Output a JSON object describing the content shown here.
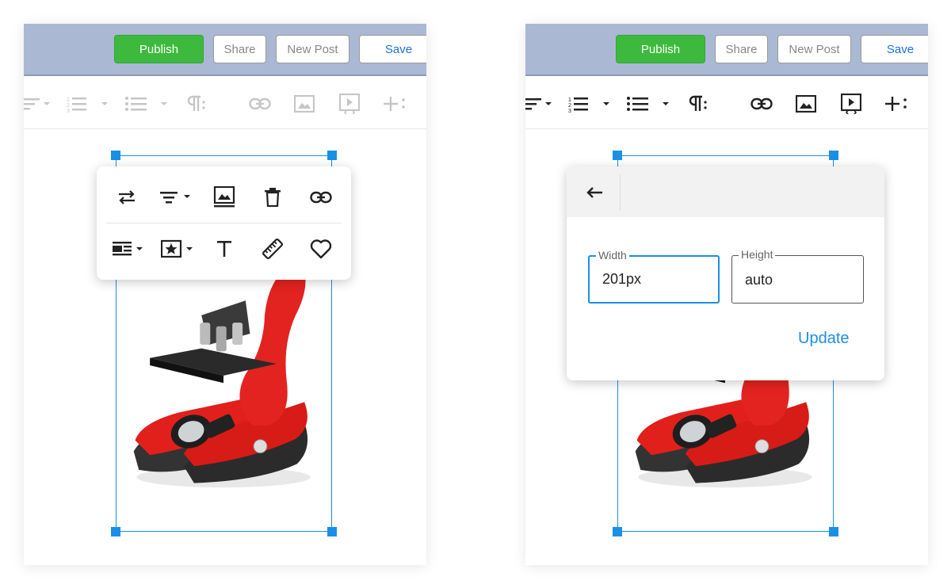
{
  "toolbar": {
    "publish_label": "Publish",
    "share_label": "Share",
    "new_post_label": "New Post",
    "save_label": "Save",
    "publish_color": "#3dba3d",
    "header_color": "#aab8d3",
    "save_color": "#1a73d9"
  },
  "format_bar": {
    "icons": [
      "align-icon",
      "ordered-list-icon",
      "unordered-list-icon",
      "paragraph-icon",
      "link-icon",
      "image-icon",
      "video-icon",
      "add-more-icon"
    ]
  },
  "image_toolbar": {
    "row1": [
      "replace-icon",
      "align-icon",
      "image-alt-icon",
      "trash-icon",
      "link-icon"
    ],
    "row2": [
      "display-icon",
      "style-icon",
      "alt-text-icon",
      "ruler-icon",
      "heart-icon"
    ]
  },
  "size_popup": {
    "back_icon": "arrow-left-icon",
    "width_label": "Width",
    "width_value": "201px",
    "height_label": "Height",
    "height_value": "auto",
    "update_label": "Update",
    "accent_color": "#1b8fe6"
  }
}
